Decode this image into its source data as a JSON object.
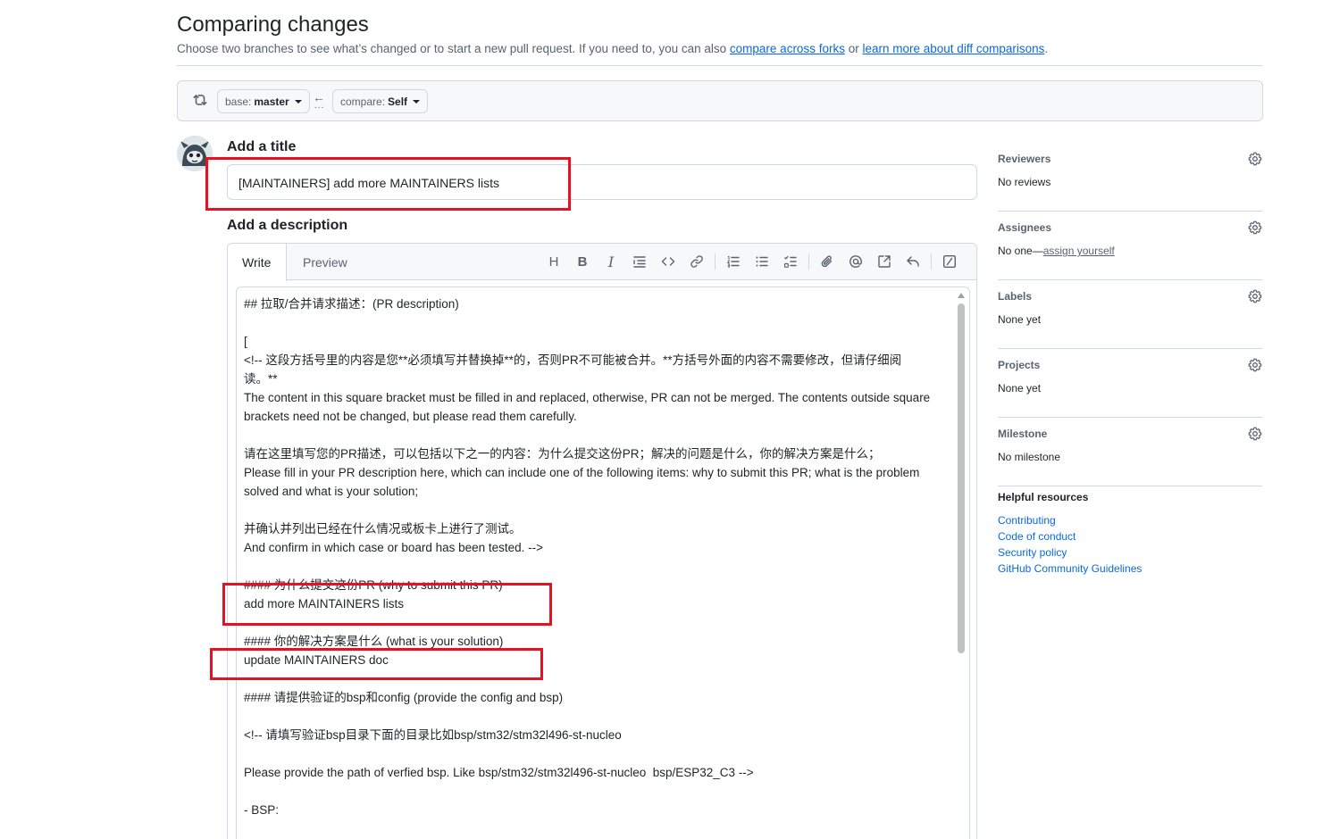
{
  "header": {
    "title": "Comparing changes",
    "subtitle_text": "Choose two branches to see what’s changed or to start a new pull request. If you need to, you can also",
    "link_forks": "compare across forks",
    "or_text": "or",
    "link_learn": "learn more about diff comparisons",
    "period": "."
  },
  "range": {
    "base_prefix": "base:",
    "base_branch": "master",
    "compare_prefix": "compare:",
    "compare_branch": "Self",
    "arrow": "←",
    "dots": "..."
  },
  "form": {
    "title_label": "Add a title",
    "title_value": "[MAINTAINERS] add more MAINTAINERS lists",
    "desc_label": "Add a description",
    "tab_write": "Write",
    "tab_preview": "Preview",
    "description_lines": [
      "## 拉取/合并请求描述：(PR description)",
      "",
      "[",
      "<!-- 这段方括号里的内容是您**必须填写并替换掉**的，否则PR不可能被合并。**方括号外面的内容不需要修改，但请仔细阅",
      "读。**",
      "The content in this square bracket must be filled in and replaced, otherwise, PR can not be merged. The contents outside square",
      "brackets need not be changed, but please read them carefully.",
      "",
      "请在这里填写您的PR描述，可以包括以下之一的内容：为什么提交这份PR；解决的问题是什么，你的解决方案是什么；",
      "Please fill in your PR description here, which can include one of the following items: why to submit this PR; what is the problem",
      "solved and what is your solution;",
      "",
      "并确认并列出已经在什么情况或板卡上进行了测试。",
      "And confirm in which case or board has been tested. -->",
      "",
      "#### 为什么提交这份PR (why to submit this PR)",
      "add more MAINTAINERS lists",
      "",
      "#### 你的解决方案是什么 (what is your solution)",
      "update MAINTAINERS doc",
      "",
      "#### 请提供验证的bsp和config (provide the config and bsp)",
      "",
      "<!-- 请填写验证bsp目录下面的目录比如bsp/stm32/stm32l496-st-nucleo",
      "",
      "Please provide the path of verfied bsp. Like bsp/stm32/stm32l496-st-nucleo  bsp/ESP32_C3 -->",
      "",
      "- BSP:",
      ""
    ]
  },
  "toolbar": {
    "heading": "H",
    "bold": "B",
    "italic": "I"
  },
  "sidebar": {
    "reviewers_title": "Reviewers",
    "reviewers_value": "No reviews",
    "assignees_title": "Assignees",
    "assignees_value": "No one—",
    "assign_yourself": "assign yourself",
    "labels_title": "Labels",
    "labels_value": "None yet",
    "projects_title": "Projects",
    "projects_value": "None yet",
    "milestone_title": "Milestone",
    "milestone_value": "No milestone",
    "resources_title": "Helpful resources",
    "resources": [
      "Contributing",
      "Code of conduct",
      "Security policy",
      "GitHub Community Guidelines"
    ]
  },
  "colors": {
    "accent": "#0969da",
    "annotation_red": "#e81123",
    "border": "#d1d9e0"
  }
}
